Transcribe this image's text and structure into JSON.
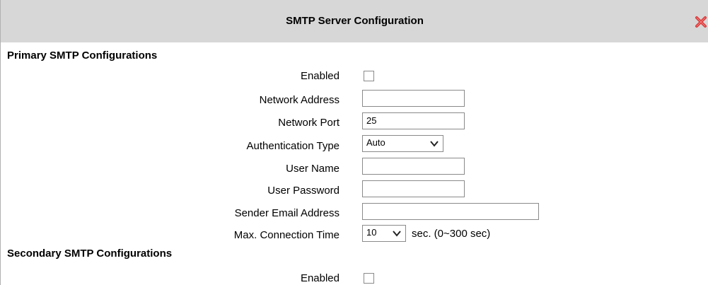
{
  "dialog": {
    "title": "SMTP Server Configuration",
    "close_icon": "close-x-icon",
    "close_color": "#d93a3a"
  },
  "primary": {
    "heading": "Primary SMTP Configurations",
    "enabled_label": "Enabled",
    "enabled_checked": false,
    "network_address_label": "Network Address",
    "network_address_value": "",
    "network_port_label": "Network Port",
    "network_port_value": "25",
    "auth_type_label": "Authentication Type",
    "auth_type_value": "Auto",
    "user_name_label": "User Name",
    "user_name_value": "",
    "user_password_label": "User Password",
    "user_password_value": "",
    "sender_email_label": "Sender Email Address",
    "sender_email_value": "",
    "max_conn_time_label": "Max. Connection Time",
    "max_conn_time_value": "10",
    "max_conn_time_suffix": "sec. (0~300 sec)"
  },
  "secondary": {
    "heading": "Secondary SMTP Configurations",
    "enabled_label": "Enabled",
    "enabled_checked": false
  }
}
